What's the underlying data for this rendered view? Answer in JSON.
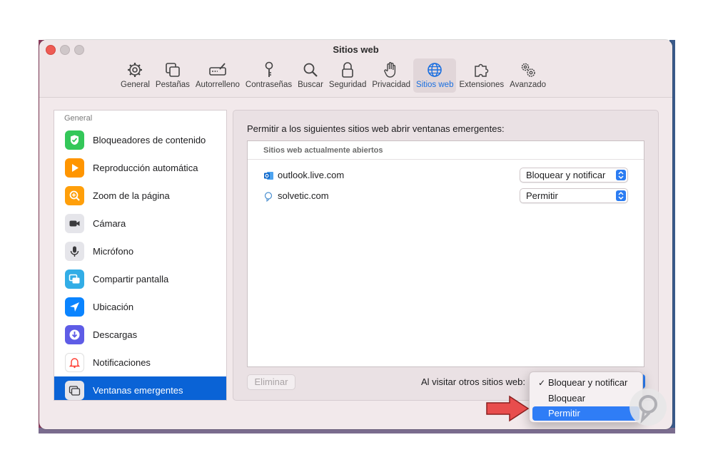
{
  "window": {
    "title": "Sitios web"
  },
  "toolbar": {
    "items": [
      {
        "label": "General",
        "icon": "gear-icon"
      },
      {
        "label": "Pestañas",
        "icon": "tabs-icon"
      },
      {
        "label": "Autorrelleno",
        "icon": "autofill-icon"
      },
      {
        "label": "Contraseñas",
        "icon": "key-icon"
      },
      {
        "label": "Buscar",
        "icon": "magnifier-icon"
      },
      {
        "label": "Seguridad",
        "icon": "lock-icon"
      },
      {
        "label": "Privacidad",
        "icon": "hand-icon"
      },
      {
        "label": "Sitios web",
        "icon": "globe-icon",
        "active": true
      },
      {
        "label": "Extensiones",
        "icon": "puzzle-icon"
      },
      {
        "label": "Avanzado",
        "icon": "gears-icon"
      }
    ]
  },
  "sidebar": {
    "header": "General",
    "items": [
      {
        "label": "Bloqueadores de contenido",
        "icon": "shield-check-icon",
        "color": "#34c759"
      },
      {
        "label": "Reproducción automática",
        "icon": "play-icon",
        "color": "#ff9500"
      },
      {
        "label": "Zoom de la página",
        "icon": "zoom-icon",
        "color": "#ff9f0a"
      },
      {
        "label": "Cámara",
        "icon": "camera-icon",
        "color": "#3a3a3c"
      },
      {
        "label": "Micrófono",
        "icon": "microphone-icon",
        "color": "#8e8e93"
      },
      {
        "label": "Compartir pantalla",
        "icon": "screen-share-icon",
        "color": "#32ade6"
      },
      {
        "label": "Ubicación",
        "icon": "location-icon",
        "color": "#0a84ff"
      },
      {
        "label": "Descargas",
        "icon": "download-icon",
        "color": "#5e5ce6"
      },
      {
        "label": "Notificaciones",
        "icon": "bell-icon",
        "color": "#ff3b30"
      },
      {
        "label": "Ventanas emergentes",
        "icon": "popup-window-icon",
        "color": "#8e8e93",
        "selected": true
      }
    ]
  },
  "panel": {
    "caption": "Permitir a los siguientes sitios web abrir ventanas emergentes:",
    "list_header": "Sitios web actualmente abiertos",
    "rows": [
      {
        "domain": "outlook.live.com",
        "icon": "outlook-icon",
        "setting": "Bloquear y notificar"
      },
      {
        "domain": "solvetic.com",
        "icon": "solvetic-icon",
        "setting": "Permitir"
      }
    ],
    "remove_button": "Eliminar",
    "other_sites_label": "Al visitar otros sitios web:"
  },
  "dropdown": {
    "options": [
      "Bloquear y notificar",
      "Bloquear",
      "Permitir"
    ],
    "checked": "Bloquear y notificar",
    "highlighted": "Permitir",
    "check_glyph": "✓"
  },
  "colors": {
    "accent": "#0a63d6",
    "highlight": "#2f7df6",
    "annotation_arrow": "#e84d4d"
  }
}
